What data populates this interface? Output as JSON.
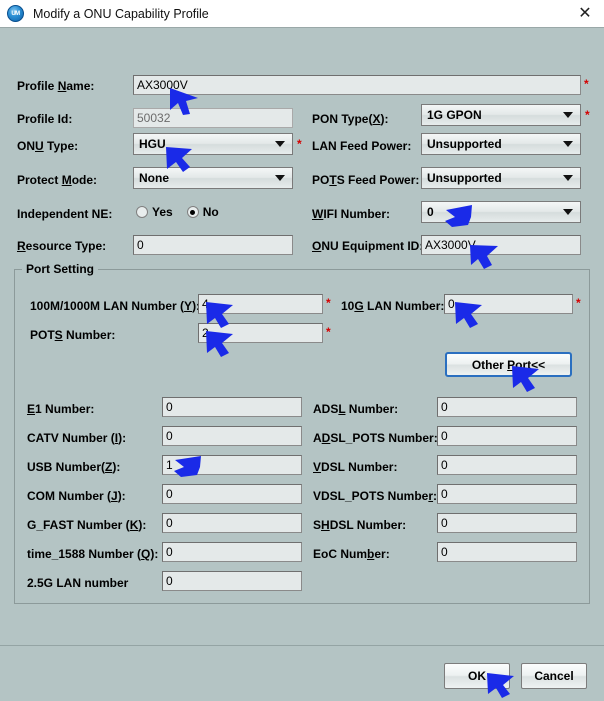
{
  "window": {
    "title": "Modify a ONU Capability Profile",
    "icon": "app-globe-icon",
    "close_label": "✕"
  },
  "form": {
    "left": [
      {
        "label_pre": "Profile ",
        "label_key": "N",
        "label_post": "ame:",
        "type": "text",
        "value": "AX3000V",
        "required": true
      },
      {
        "label_pre": "Profile Id:",
        "label_key": "",
        "label_post": "",
        "type": "text",
        "value": "50032",
        "required": false,
        "disabled": true
      },
      {
        "label_pre": "ON",
        "label_key": "U",
        "label_post": " Type:",
        "type": "combo",
        "value": "HGU",
        "required": true
      },
      {
        "label_pre": "Protect ",
        "label_key": "M",
        "label_post": "ode:",
        "type": "combo",
        "value": "None",
        "required": false
      },
      {
        "label_pre": "Independent NE:",
        "label_key": "",
        "label_post": "",
        "type": "radio",
        "value": "No",
        "required": false
      },
      {
        "label_pre": "",
        "label_key": "R",
        "label_post": "esource Type:",
        "type": "text",
        "value": "0",
        "required": false
      }
    ],
    "right": [
      {
        "label_pre": "PON Type(",
        "label_key": "X",
        "label_post": "):",
        "type": "combo",
        "value": "1G GPON",
        "required": true
      },
      {
        "label_pre": "LAN Feed Power:",
        "label_key": "",
        "label_post": "",
        "type": "combo",
        "value": "Unsupported",
        "required": false
      },
      {
        "label_pre": "PO",
        "label_key": "T",
        "label_post": "S Feed Power:",
        "type": "combo",
        "value": "Unsupported",
        "required": false
      },
      {
        "label_pre": "",
        "label_key": "W",
        "label_post": "IFI Number:",
        "type": "combo",
        "value": "0",
        "required": false
      },
      {
        "label_pre": "",
        "label_key": "O",
        "label_post": "NU Equipment ID:",
        "type": "text",
        "value": "AX3000V",
        "required": false
      }
    ],
    "radio_options": [
      {
        "label": "Yes",
        "checked": false
      },
      {
        "label": "No",
        "checked": true
      }
    ]
  },
  "port_setting": {
    "title": "Port Setting",
    "primary": [
      {
        "label_pre": "100M/1000M LAN Number (",
        "label_key": "Y",
        "label_post": "):",
        "value": "4",
        "required": true
      },
      {
        "label_pre": "10",
        "label_key": "G",
        "label_post": " LAN Number:",
        "value": "0",
        "required": true
      },
      {
        "label_pre": "POT",
        "label_key": "S",
        "label_post": " Number:",
        "value": "2",
        "required": true
      }
    ],
    "other_port_button": {
      "pre": "Other ",
      "key": "P",
      "post": "ort<<"
    },
    "left_fields": [
      {
        "label_pre": "",
        "label_key": "E",
        "label_post": "1 Number:",
        "value": "0"
      },
      {
        "label_pre": "CATV Number (",
        "label_key": "I",
        "label_post": "):",
        "value": "0"
      },
      {
        "label_pre": "USB Number(",
        "label_key": "Z",
        "label_post": "):",
        "value": "1"
      },
      {
        "label_pre": "COM Number (",
        "label_key": "J",
        "label_post": "):",
        "value": "0"
      },
      {
        "label_pre": "G_FAST Number (",
        "label_key": "K",
        "label_post": "):",
        "value": "0"
      },
      {
        "label_pre": "time_1588 Number (",
        "label_key": "Q",
        "label_post": "):",
        "value": "0"
      },
      {
        "label_pre": "2.5G LAN number",
        "label_key": "",
        "label_post": "",
        "value": "0"
      }
    ],
    "right_fields": [
      {
        "label_pre": "ADS",
        "label_key": "L",
        "label_post": " Number:",
        "value": "0"
      },
      {
        "label_pre": "A",
        "label_key": "D",
        "label_post": "SL_POTS Number:",
        "value": "0"
      },
      {
        "label_pre": "",
        "label_key": "V",
        "label_post": "DSL Number:",
        "value": "0"
      },
      {
        "label_pre": "VDSL_POTS Numbe",
        "label_key": "r",
        "label_post": ":",
        "value": "0"
      },
      {
        "label_pre": "S",
        "label_key": "H",
        "label_post": "DSL Number:",
        "value": "0"
      },
      {
        "label_pre": "EoC Num",
        "label_key": "b",
        "label_post": "er:",
        "value": "0"
      }
    ]
  },
  "footer": {
    "ok_label": "OK",
    "cancel_label": "Cancel"
  },
  "colors": {
    "background": "#b4c4c4",
    "field_background": "#e4e9e9",
    "required_marker": "#d40000",
    "focus_border": "#2a6fc0",
    "cursor_blue": "#1a2ae8"
  }
}
